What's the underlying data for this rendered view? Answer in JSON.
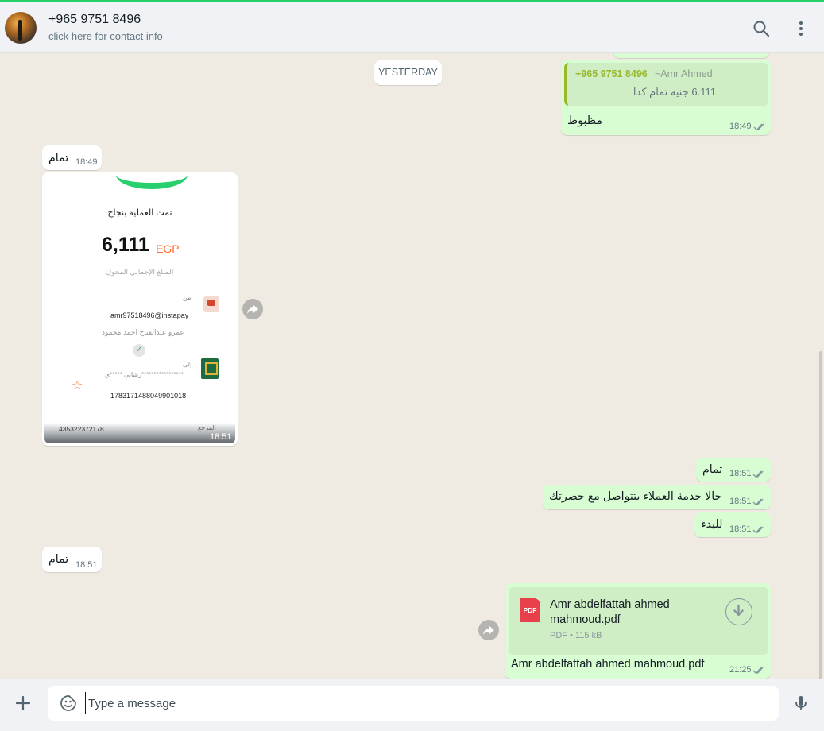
{
  "header": {
    "contact_name": "+965 9751 8496",
    "contact_subtitle": "click here for contact info",
    "search_icon": "search-icon",
    "menu_icon": "kebab-menu-icon"
  },
  "chat": {
    "day_separator": "YESTERDAY",
    "reply_message": {
      "quoted_phone": "+965 9751 8496",
      "quoted_author": "~Amr Ahmed",
      "quoted_text": "6.111 جنيه تمام كدا",
      "text": "مظبوط",
      "time": "18:49",
      "status": "read"
    },
    "incoming_1": {
      "text": "تمام",
      "time": "18:49"
    },
    "receipt_image": {
      "status_text": "تمت العملية بنجاح",
      "amount": "6,111",
      "currency": "EGP",
      "total_label": "المبلغ الإجمالي المحول",
      "from_label": "من",
      "from_address": "amr97518496@instapay",
      "from_name": "عمرو عبدالفتاح احمد محمود",
      "to_label": "إلى",
      "to_masked": "رشاني *****ي*****************",
      "account_number": "1783171488049901018",
      "reference_label": "المرجع",
      "reference_number": "435322372178",
      "time": "18:51"
    },
    "outgoing_1": {
      "text": "تمام",
      "time": "18:51",
      "status": "read"
    },
    "outgoing_2": {
      "text": "حالا خدمة العملاء بتتواصل مع حضرتك",
      "time": "18:51",
      "status": "read"
    },
    "outgoing_3": {
      "text": "للبدء",
      "time": "18:51",
      "status": "read"
    },
    "incoming_2": {
      "text": "تمام",
      "time": "18:51"
    },
    "file_message": {
      "file_icon_label": "PDF",
      "file_name": "Amr abdelfattah ahmed mahmoud.pdf",
      "file_type": "PDF",
      "file_size": "115 kB",
      "caption": "Amr abdelfattah ahmed mahmoud.pdf",
      "time": "21:25",
      "status": "read"
    }
  },
  "composer": {
    "placeholder": "Type a message",
    "attach_icon": "plus-icon",
    "emoji_icon": "emoji-icon",
    "mic_icon": "microphone-icon"
  },
  "colors": {
    "incoming_bubble": "#ffffff",
    "outgoing_bubble": "#d9fdd3",
    "accent": "#25d366",
    "chat_background": "#efeae2",
    "read_ticks": "#8696a0"
  }
}
